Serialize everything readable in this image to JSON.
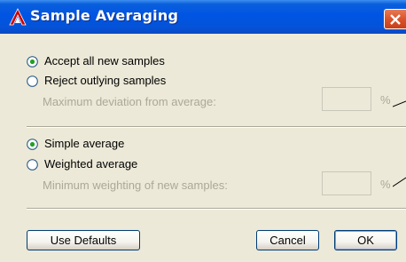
{
  "window": {
    "title": "Sample Averaging"
  },
  "icons": {
    "app": "autodesk-a-icon",
    "close": "close-icon",
    "radio_selected": "radio-selected-icon",
    "radio_unselected": "radio-unselected-icon"
  },
  "colors": {
    "titlebar": "#0054e3",
    "close_button": "#d9532b",
    "dialog_background": "#ece9d8",
    "disabled_text": "#aca899"
  },
  "sample_filter": {
    "accept_label": "Accept all new samples",
    "accept_selected": true,
    "reject_label": "Reject outlying samples",
    "reject_selected": false,
    "deviation_label": "Maximum deviation from average:",
    "deviation_value": "",
    "deviation_unit": "%"
  },
  "average_type": {
    "simple_label": "Simple average",
    "simple_selected": true,
    "weighted_label": "Weighted average",
    "weighted_selected": false,
    "weighting_label": "Minimum weighting of new samples:",
    "weighting_value": "",
    "weighting_unit": "%"
  },
  "buttons": {
    "defaults_label": "Use Defaults",
    "cancel_label": "Cancel",
    "ok_label": "OK"
  }
}
